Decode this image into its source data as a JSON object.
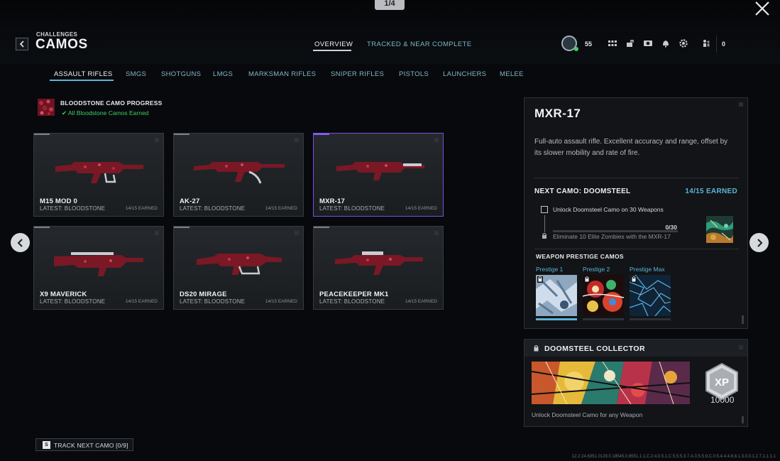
{
  "page_counter": "1/4",
  "header": {
    "breadcrumb_small": "CHALLENGES",
    "breadcrumb_big": "CAMOS",
    "tabs": [
      {
        "label": "OVERVIEW"
      },
      {
        "label": "TRACKED & NEAR COMPLETE"
      }
    ],
    "player_level": "55",
    "friends_count": "0"
  },
  "categories": [
    {
      "label": "ASSAULT RIFLES"
    },
    {
      "label": "SMGS"
    },
    {
      "label": "SHOTGUNS"
    },
    {
      "label": "LMGS"
    },
    {
      "label": "MARKSMAN RIFLES"
    },
    {
      "label": "SNIPER RIFLES"
    },
    {
      "label": "PISTOLS"
    },
    {
      "label": "LAUNCHERS"
    },
    {
      "label": "MELEE"
    }
  ],
  "camo_progress": {
    "title": "BLOODSTONE CAMO PROGRESS",
    "status": "✔ All Bloodstone Camos Earned"
  },
  "weapons": [
    {
      "name": "M15 MOD 0",
      "latest": "LATEST: BLOODSTONE",
      "earned": "14/15 EARNED"
    },
    {
      "name": "AK-27",
      "latest": "LATEST: BLOODSTONE",
      "earned": "14/15 EARNED"
    },
    {
      "name": "MXR-17",
      "latest": "LATEST: BLOODSTONE",
      "earned": "14/15 EARNED"
    },
    {
      "name": "X9 MAVERICK",
      "latest": "LATEST: BLOODSTONE",
      "earned": "14/15 EARNED"
    },
    {
      "name": "DS20 MIRAGE",
      "latest": "LATEST: BLOODSTONE",
      "earned": "14/15 EARNED"
    },
    {
      "name": "PEACEKEEPER MK1",
      "latest": "LATEST: BLOODSTONE",
      "earned": "14/15 EARNED"
    }
  ],
  "detail": {
    "title": "MXR-17",
    "description": "Full-auto assault rifle. Excellent accuracy and range, offset by its slower mobility and rate of fire.",
    "next_camo": "NEXT CAMO: DOOMSTEEL",
    "next_earned": "14/15 EARNED",
    "task1": "Unlock Doomsteel Camo on 30 Weapons",
    "task1_count": "0/30",
    "task1_progress": 0,
    "task2": "Eliminate 10 Elite Zombies with the MXR-17",
    "prestige_title": "WEAPON PRESTIGE CAMOS",
    "prestige": [
      {
        "label": "Prestige 1"
      },
      {
        "label": "Prestige 2"
      },
      {
        "label": "Prestige Max"
      }
    ]
  },
  "collector": {
    "title": "DOOMSTEEL COLLECTOR",
    "xp_badge": "XP",
    "xp_amount": "10000",
    "description": "Unlock Doomsteel Camo for any Weapon"
  },
  "track_button": {
    "key": "S",
    "label": "TRACK NEXT CAMO [0/9]"
  },
  "build_string": "12.2.24.6351.0129.0.18545.0.6551.1.1.C.2.4.0.5.1.C.5.5.5.3.7.A.0.5.5.9.C.0.5.4.4.4.6.8.1.3.0.0.1.2.7.1.1.1.1",
  "colors": {
    "accent_blue": "#5ab4d8",
    "earned_green": "#3fce62",
    "selected_purple": "#7b4fe0",
    "bloodstone_red": "#8b1c2c"
  }
}
